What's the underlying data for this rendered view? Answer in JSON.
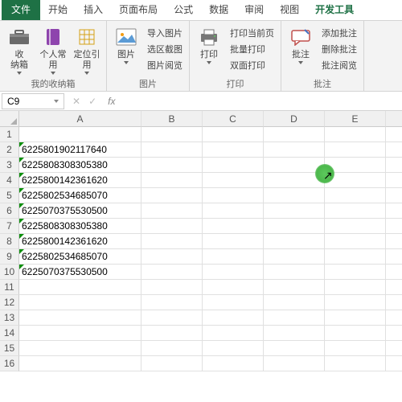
{
  "tabs": {
    "file": "文件",
    "items": [
      "开始",
      "插入",
      "页面布局",
      "公式",
      "数据",
      "审阅",
      "视图",
      "开发工具"
    ]
  },
  "ribbon": {
    "g0": {
      "label": "我的收纳箱",
      "b0": [
        "收",
        "纳箱"
      ],
      "b1": [
        "个人常",
        "用"
      ],
      "b2": [
        "定位引",
        "用"
      ]
    },
    "g1": {
      "label": "图片",
      "b0": [
        "图片",
        ""
      ],
      "s": [
        "导入图片",
        "选区截图",
        "图片阅览"
      ]
    },
    "g2": {
      "label": "打印",
      "b0": [
        "打印",
        ""
      ],
      "s": [
        "打印当前页",
        "批量打印",
        "双面打印"
      ]
    },
    "g3": {
      "label": "批注",
      "b0": [
        "批注",
        ""
      ],
      "s": [
        "添加批注",
        "删除批注",
        "批注阅览"
      ]
    }
  },
  "namebox": {
    "ref": "C9",
    "fx": "fx"
  },
  "cols": [
    "A",
    "B",
    "C",
    "D",
    "E"
  ],
  "rows": [
    "1",
    "2",
    "3",
    "4",
    "5",
    "6",
    "7",
    "8",
    "9",
    "10",
    "11",
    "12",
    "13",
    "14",
    "15",
    "16"
  ],
  "data": {
    "2": "6225801902117640",
    "3": "6225808308305380",
    "4": "6225800142361620",
    "5": "6225802534685070",
    "6": "6225070375530500",
    "7": "6225808308305380",
    "8": "6225800142361620",
    "9": "6225802534685070",
    "10": "6225070375530500"
  }
}
